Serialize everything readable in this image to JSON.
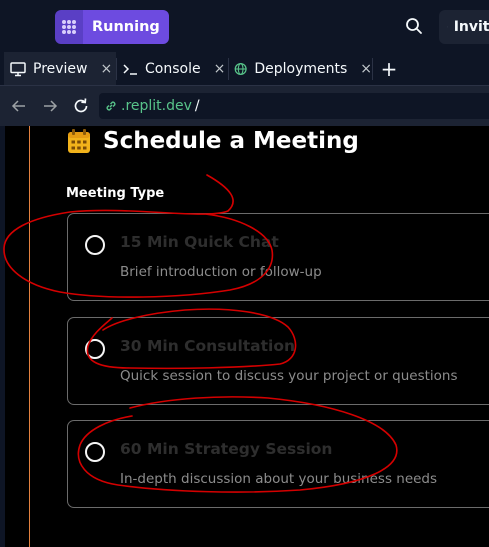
{
  "header": {
    "run_button_label": "Running",
    "invite_label": "Invite",
    "icons": {
      "stop": "grid-stop-icon",
      "search": "search-icon",
      "invite": "add-user-icon"
    }
  },
  "tabs": [
    {
      "label": "Preview",
      "icon": "monitor-icon",
      "active": true
    },
    {
      "label": "Console",
      "icon": "terminal-icon",
      "active": false
    },
    {
      "label": "Deployments",
      "icon": "globe-icon",
      "active": false
    }
  ],
  "tab_close_glyph": "×",
  "tab_add_glyph": "+",
  "address": {
    "host": ".replit.dev",
    "path": "/"
  },
  "page": {
    "title": "Schedule a Meeting",
    "title_icon": "calendar-icon",
    "section_label": "Meeting Type",
    "options": [
      {
        "title": "15 Min Quick Chat",
        "description": "Brief introduction or follow-up"
      },
      {
        "title": "30 Min Consultation",
        "description": "Quick session to discuss your project or questions"
      },
      {
        "title": "60 Min Strategy Session",
        "description": "In-depth discussion about your business needs"
      }
    ]
  },
  "colors": {
    "accent": "#6d4be0",
    "annotation": "#d40000",
    "calendar": "#f2b31b",
    "url_host": "#58c48a"
  }
}
